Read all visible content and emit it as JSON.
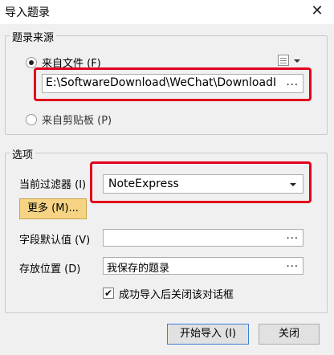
{
  "window": {
    "title": "导入题录",
    "close_glyph": "✕"
  },
  "source_group": {
    "title": "题录来源",
    "from_file_label": "来自文件 (F)",
    "file_path": "E:\\SoftwareDownload\\WeChat\\DownloadI",
    "browse_glyph": "...",
    "from_clipboard_label": "来自剪贴板 (P)",
    "selected": "from_file"
  },
  "options_group": {
    "title": "选项",
    "filter_label": "当前过滤器 (I)",
    "filter_value": "NoteExpress",
    "more_button": "更多 (M)...",
    "field_default_label": "字段默认值 (V)",
    "field_default_value": "",
    "field_default_browse": "...",
    "save_location_label": "存放位置 (D)",
    "save_location_value": "我保存的题录",
    "save_location_browse": "...",
    "close_after_label": "成功导入后关闭该对话框",
    "close_after_checked": true,
    "check_glyph": "✔"
  },
  "footer": {
    "start_button": "开始导入 (I)",
    "close_button": "关闭"
  },
  "colors": {
    "highlight": "#e0001b",
    "more_button": "#f6d483",
    "primary_border": "#3c7fd8"
  }
}
